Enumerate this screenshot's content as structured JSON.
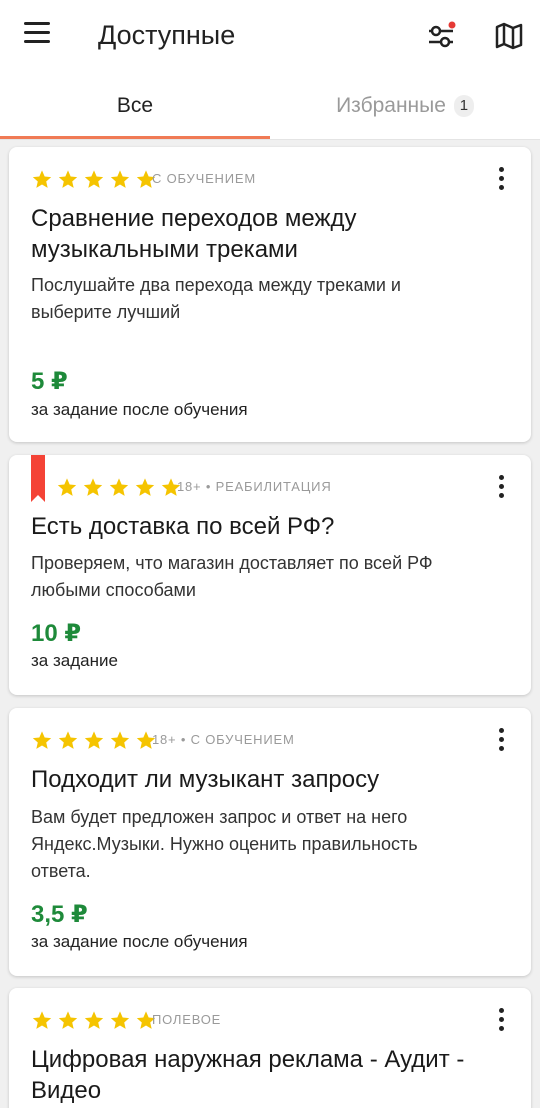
{
  "header": {
    "title": "Доступные",
    "icons": [
      "menu-icon",
      "filter-icon",
      "map-icon"
    ],
    "filter_indicator_color": "#e53935"
  },
  "tabs": {
    "all": "Все",
    "favorites": "Избранные",
    "favorites_count": "1",
    "active_color": "#f07a55"
  },
  "colors": {
    "star": "#f5c400",
    "price": "#1e8a3a",
    "bookmark": "#f44336"
  },
  "cards": [
    {
      "rating": 5,
      "tags": "С ОБУЧЕНИЕМ",
      "title_line1": "Сравнение переходов между",
      "title_line2": "музыкальными треками",
      "desc_line1": "Послушайте два перехода между треками и",
      "desc_line2": "выберите лучший",
      "price": "5 ₽",
      "price_note": "за задание после обучения"
    },
    {
      "rating": 5,
      "bookmarked": true,
      "tags": "18+ • РЕАБИЛИТАЦИЯ",
      "title_line1": "Есть доставка по всей РФ?",
      "desc_line1": "Проверяем, что магазин доставляет по всей РФ",
      "desc_line2": "любыми способами",
      "price": "10 ₽",
      "price_note": "за задание"
    },
    {
      "rating": 5,
      "tags": "18+ • С ОБУЧЕНИЕМ",
      "title_line1": "Подходит ли музыкант запросу",
      "desc_line1": "Вам будет предложен запрос и ответ на него",
      "desc_line2": "Яндекс.Музыки. Нужно оценить правильность",
      "desc_line3": "ответа.",
      "price": "3,5 ₽",
      "price_note": "за задание после обучения"
    },
    {
      "rating": 5,
      "tags": "ПОЛЕВОЕ",
      "title_line1": "Цифровая наружная реклама - Аудит -",
      "title_line2": "Видео"
    }
  ]
}
